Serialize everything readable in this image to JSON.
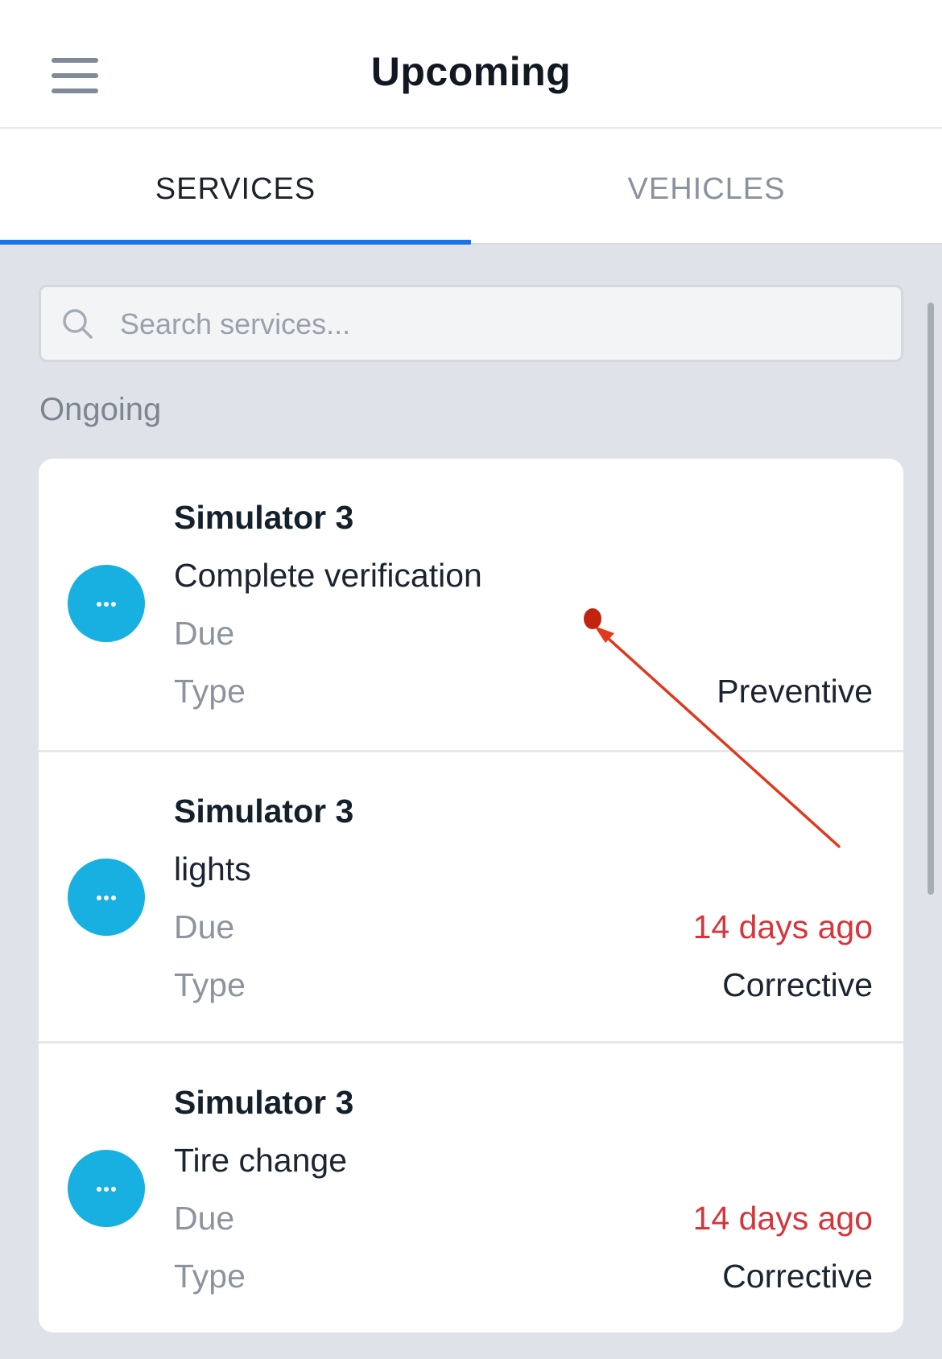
{
  "header": {
    "title": "Upcoming",
    "menu_icon": "hamburger-menu-icon"
  },
  "tabs": [
    {
      "label": "SERVICES",
      "active": true
    },
    {
      "label": "VEHICLES",
      "active": false
    }
  ],
  "search": {
    "placeholder": "Search services...",
    "value": "",
    "icon": "search-icon"
  },
  "section": {
    "label": "Ongoing"
  },
  "services": [
    {
      "vehicle": "Simulator 3",
      "task": "Complete verification",
      "due_label": "Due",
      "due_value": "",
      "type_label": "Type",
      "type_value": "Preventive",
      "icon": "more-dots-icon"
    },
    {
      "vehicle": "Simulator 3",
      "task": "lights",
      "due_label": "Due",
      "due_value": "14 days ago",
      "type_label": "Type",
      "type_value": "Corrective",
      "icon": "more-dots-icon"
    },
    {
      "vehicle": "Simulator 3",
      "task": "Tire change",
      "due_label": "Due",
      "due_value": "14 days ago",
      "type_label": "Type",
      "type_value": "Corrective",
      "icon": "more-dots-icon"
    }
  ],
  "colors": {
    "accent": "#1a73e8",
    "avatar": "#18b0e0",
    "overdue": "#d5353b",
    "background": "#dfe3e9",
    "annotation_arrow": "#e0391c"
  }
}
